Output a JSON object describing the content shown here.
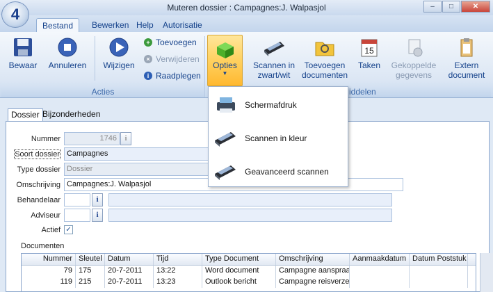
{
  "window": {
    "title": "Muteren dossier : Campagnes:J. Walpasjol",
    "logo_text": "4"
  },
  "ribbon_tabs": [
    {
      "label": "Bestand",
      "active": true
    },
    {
      "label": "Bewerken",
      "active": false
    },
    {
      "label": "Help",
      "active": false
    },
    {
      "label": "Autorisatie",
      "active": false
    }
  ],
  "ribbon": {
    "bewaar": "Bewaar",
    "annuleren": "Annuleren",
    "wijzigen": "Wijzigen",
    "toevoegen": "Toevoegen",
    "verwijderen": "Verwijderen",
    "raadplegen": "Raadplegen",
    "acties_group": "Acties",
    "opties": "Opties",
    "scannen_zw_1": "Scannen in",
    "scannen_zw_2": "zwart/wit",
    "toevoegen_doc_1": "Toevoegen",
    "toevoegen_doc_2": "documenten",
    "taken": "Taken",
    "gekoppelde_1": "Gekoppelde",
    "gekoppelde_2": "gegevens",
    "extern_1": "Extern",
    "extern_2": "document",
    "middelen_group_partial": "iddelen",
    "calendar_day": "15"
  },
  "opties_menu": [
    {
      "label": "Schermafdruk",
      "icon": "printer-icon"
    },
    {
      "label": "Scannen in kleur",
      "icon": "scanner-icon"
    },
    {
      "label": "Geavanceerd scannen",
      "icon": "scanner-icon"
    }
  ],
  "subtabs": [
    {
      "label": "Dossier",
      "active": true
    },
    {
      "label": "Bijzonderheden",
      "active": false
    }
  ],
  "form": {
    "nummer_label": "Nummer",
    "nummer_value": "1746",
    "soort_label": "Soort dossier",
    "soort_value": "Campagnes",
    "type_label": "Type dossier",
    "type_value": "Dossier",
    "omschrijving_label": "Omschrijving",
    "omschrijving_value": "Campagnes:J. Walpasjol",
    "behandelaar_label": "Behandelaar",
    "adviseur_label": "Adviseur",
    "actief_label": "Actief",
    "actief_checked": "✓",
    "info_button": "i"
  },
  "documents": {
    "title": "Documenten",
    "columns": [
      "Nummer",
      "Sleutel",
      "Datum",
      "Tijd",
      "Type Document",
      "Omschrijving",
      "Aanmaakdatum",
      "Datum Poststuk"
    ],
    "rows": [
      [
        "79",
        "175",
        "20-7-2011",
        "13:22",
        "Word document",
        "Campagne aanspraak",
        "",
        ""
      ],
      [
        "119",
        "215",
        "20-7-2011",
        "13:23",
        "Outlook bericht",
        "Campagne reisverzekering",
        "",
        ""
      ]
    ]
  },
  "colors": {
    "accent": "#15428b",
    "highlight": "#ffd160"
  }
}
